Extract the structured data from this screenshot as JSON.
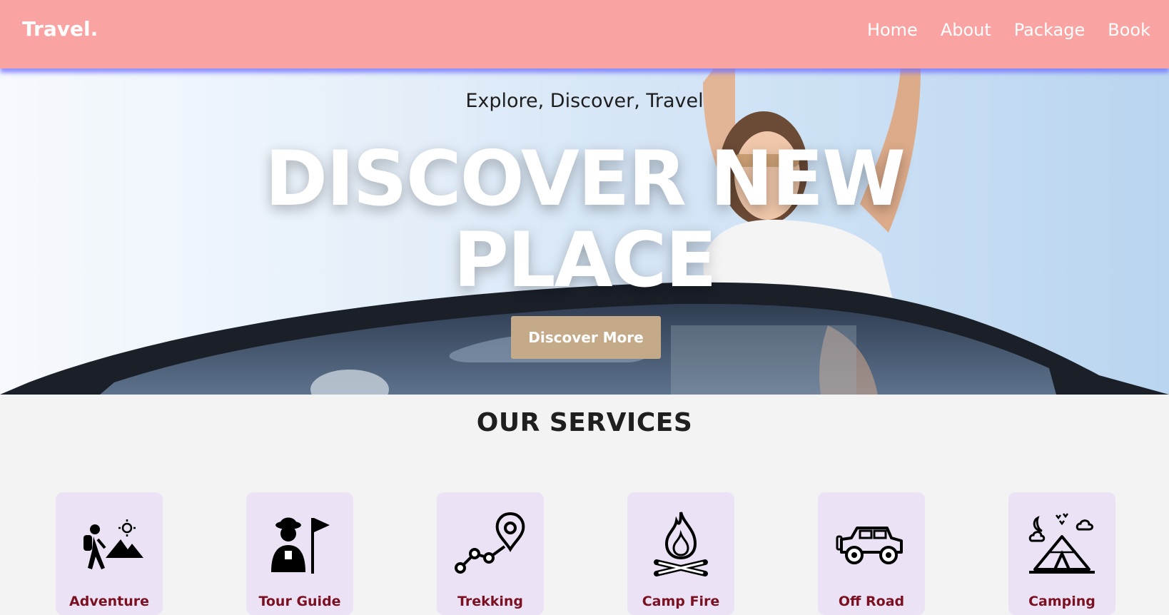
{
  "header": {
    "logo": "Travel.",
    "nav": [
      "Home",
      "About",
      "Package",
      "Book"
    ],
    "colors": {
      "background": "#f9a3a3",
      "text": "#ffffff"
    }
  },
  "hero": {
    "tagline": "Explore, Discover, Travel",
    "title_line1": "DISCOVER NEW",
    "title_line2": "PLACE",
    "button": "Discover More",
    "button_color": "#c4aa88"
  },
  "services": {
    "heading": "OUR SERVICES",
    "items": [
      {
        "label": "Adventure",
        "icon": "hiker-mountains-icon"
      },
      {
        "label": "Tour Guide",
        "icon": "tour-guide-flag-icon"
      },
      {
        "label": "Trekking",
        "icon": "trail-route-pin-icon"
      },
      {
        "label": "Camp Fire",
        "icon": "campfire-icon"
      },
      {
        "label": "Off Road",
        "icon": "jeep-icon"
      },
      {
        "label": "Camping",
        "icon": "tent-night-icon"
      }
    ],
    "card_color": "#ece2f6",
    "label_color": "#7a1020"
  }
}
